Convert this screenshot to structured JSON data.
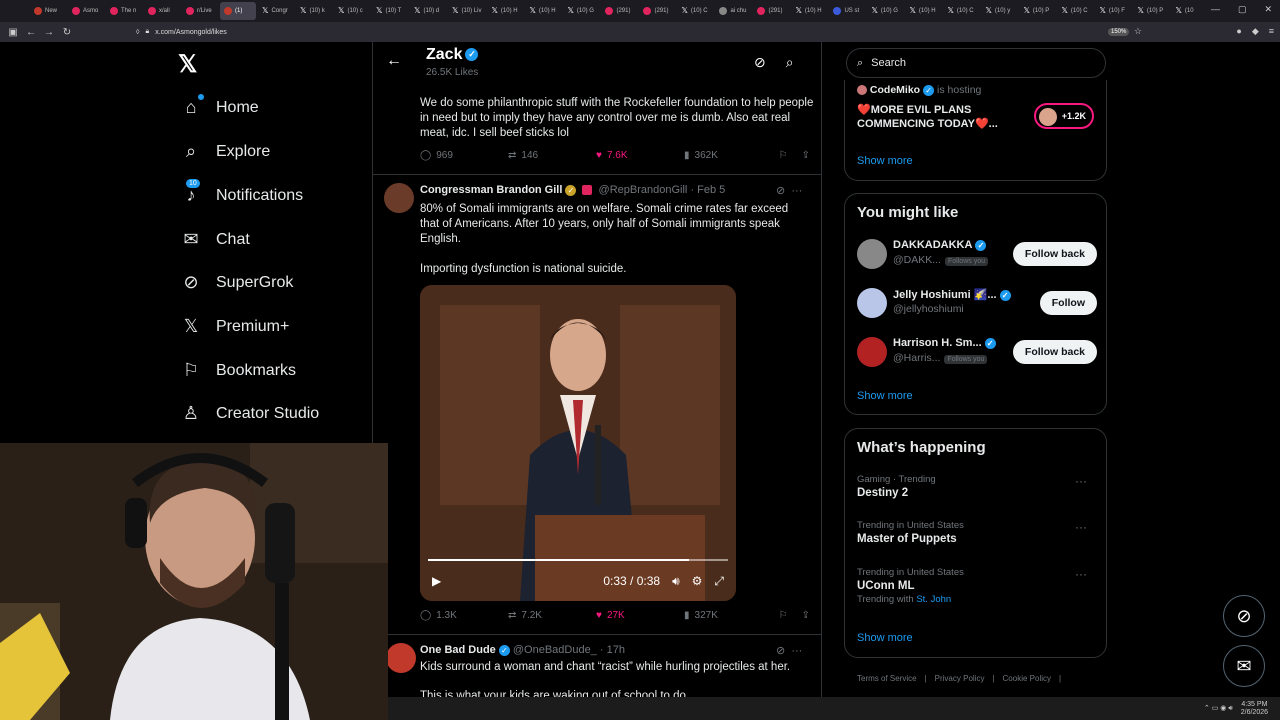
{
  "browser": {
    "tabs": [
      "New",
      "Asmo",
      "The n",
      "x/all",
      "r/Live",
      "(1)",
      "Congr",
      "(10) k",
      "(10) c",
      "(10) T",
      "(10) d",
      "(10) Liv",
      "(10) H",
      "(10) H",
      "(10) G",
      "(291)",
      "(291)",
      "(10) C",
      "ai chu",
      "(291)",
      "(10) H",
      "US st",
      "(10) G",
      "(10) H",
      "(10) C",
      "(10) y",
      "(10) P",
      "(10) C",
      "(10) F",
      "(10) P",
      "(10"
    ],
    "url": "x.com/Asmongold/likes",
    "zoom": "150%"
  },
  "nav": {
    "items": [
      {
        "label": "Home",
        "icon": "home-icon"
      },
      {
        "label": "Explore",
        "icon": "search-icon"
      },
      {
        "label": "Notifications",
        "icon": "bell-icon",
        "badge": "10"
      },
      {
        "label": "Chat",
        "icon": "mail-icon"
      },
      {
        "label": "SuperGrok",
        "icon": "grok-icon"
      },
      {
        "label": "Premium+",
        "icon": "x-icon"
      },
      {
        "label": "Bookmarks",
        "icon": "bookmark-icon"
      },
      {
        "label": "Creator Studio",
        "icon": "flask-icon"
      }
    ]
  },
  "header": {
    "name": "Zack",
    "sub": "26.5K Likes"
  },
  "tweet1": {
    "text": "We do some philanthropic stuff with the Rockefeller foundation to help people in need but to imply they have any control over me is dumb. Also eat real meat, idc. I sell beef sticks lol",
    "replies": "969",
    "reposts": "146",
    "likes": "7.6K",
    "views": "362K"
  },
  "tweet2": {
    "name": "Congressman Brandon Gill",
    "handle": "@RepBrandonGill",
    "date": "· Feb 5",
    "text1": "80% of Somali immigrants are on welfare. Somali crime rates far exceed that of Americans. After 10 years, only half of Somali immigrants speak English.",
    "text2": "Importing dysfunction is national suicide.",
    "video_time": "0:33 / 0:38",
    "video_progress": 0.87,
    "replies": "1.3K",
    "reposts": "7.2K",
    "likes": "27K",
    "views": "327K"
  },
  "tweet3": {
    "name": "One Bad Dude",
    "handle": "@OneBadDude_",
    "date": "· 17h",
    "text": "Kids surround a woman and chant “racist” while hurling projectiles at her.",
    "text2": "This is what your kids are waking out of school to do"
  },
  "right": {
    "search_placeholder": "Search",
    "live": {
      "host": "CodeMiko",
      "hosting": "is hosting",
      "title": "❤️MORE EVIL PLANS COMMENCING TODAY❤️...",
      "count": "+1.2K"
    },
    "show_more": "Show more",
    "you_might_like": "You might like",
    "suggestions": [
      {
        "name": "DAKKADAKKA",
        "handle": "@DAKK...",
        "follows_you": "Follows you",
        "button": "Follow back",
        "color": "#888"
      },
      {
        "name": "Jelly Hoshiumi 🌠...",
        "handle": "@jellyhoshiumi",
        "follows_you": "",
        "button": "Follow",
        "color": "#b9c6e8"
      },
      {
        "name": "Harrison H. Sm...",
        "handle": "@Harris...",
        "follows_you": "Follows you",
        "button": "Follow back",
        "color": "#b22222"
      }
    ],
    "whats_happening": "What’s happening",
    "trends": [
      {
        "category": "Gaming · Trending",
        "title": "Destiny 2",
        "with": "",
        "with_link": ""
      },
      {
        "category": "Trending in United States",
        "title": "Master of Puppets",
        "with": "",
        "with_link": ""
      },
      {
        "category": "Trending in United States",
        "title": "UConn ML",
        "with": "Trending with",
        "with_link": "St. John"
      }
    ],
    "footer": [
      "Terms of Service",
      "|",
      "Privacy Policy",
      "|",
      "Cookie Policy",
      "|"
    ]
  },
  "taskbar": {
    "time": "4:35 PM",
    "date": "2/6/2026"
  }
}
